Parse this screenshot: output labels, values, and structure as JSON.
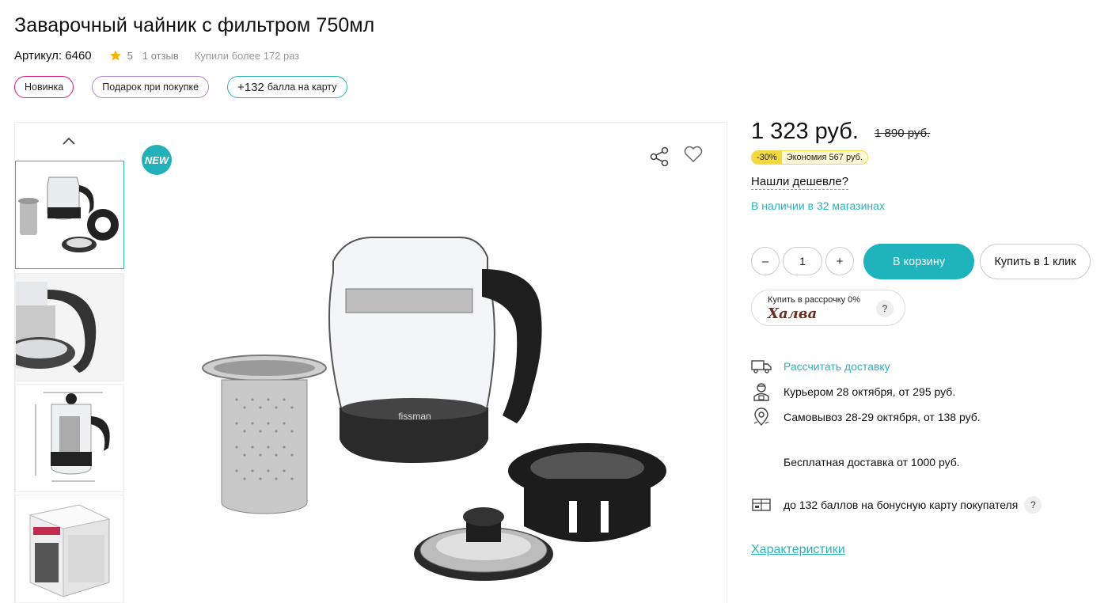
{
  "product": {
    "title": "Заварочный чайник с фильтром 750мл",
    "sku": "Артикул: 6460",
    "rating": "5",
    "reviews": "1 отзыв",
    "bought": "Купили более 172 раз"
  },
  "badges": [
    {
      "label": "Новинка",
      "color": "#d61f72"
    },
    {
      "label": "Подарок при покупке",
      "color": "#b186d0"
    },
    {
      "label_big": "+132",
      "label": "балла на карту",
      "color": "#2bb3b9"
    }
  ],
  "gallery": {
    "new_badge": "NEW",
    "image_brand": "fissman"
  },
  "price": {
    "current": "1 323 руб.",
    "old": "1 890 руб.",
    "discount_pct": "-30%",
    "savings": "Экономия 567 руб.",
    "found_cheaper": "Нашли дешевле?",
    "stock": "В наличии в 32 магазинах"
  },
  "purchase": {
    "minus": "–",
    "quantity": "1",
    "plus": "+",
    "cart_button": "В корзину",
    "oneclick_button": "Купить в 1 клик",
    "installment_text": "Купить в рассрочку 0%",
    "installment_brand": "Халва",
    "help": "?"
  },
  "delivery": {
    "calc": "Рассчитать доставку",
    "courier": "Курьером 28 октября, от 295 руб.",
    "pickup": "Самовывоз 28-29 октября, от 138 руб.",
    "free": "Бесплатная доставка от 1000 руб.",
    "bonus": "до 132 баллов на бонусную карту покупателя",
    "help": "?"
  },
  "characteristics_link": "Характеристики",
  "colors": {
    "accent": "#1fb3bd",
    "new_badge_border": "#d61f72",
    "gift_badge_border": "#b186d0",
    "discount_yellow": "#f4d93e"
  }
}
